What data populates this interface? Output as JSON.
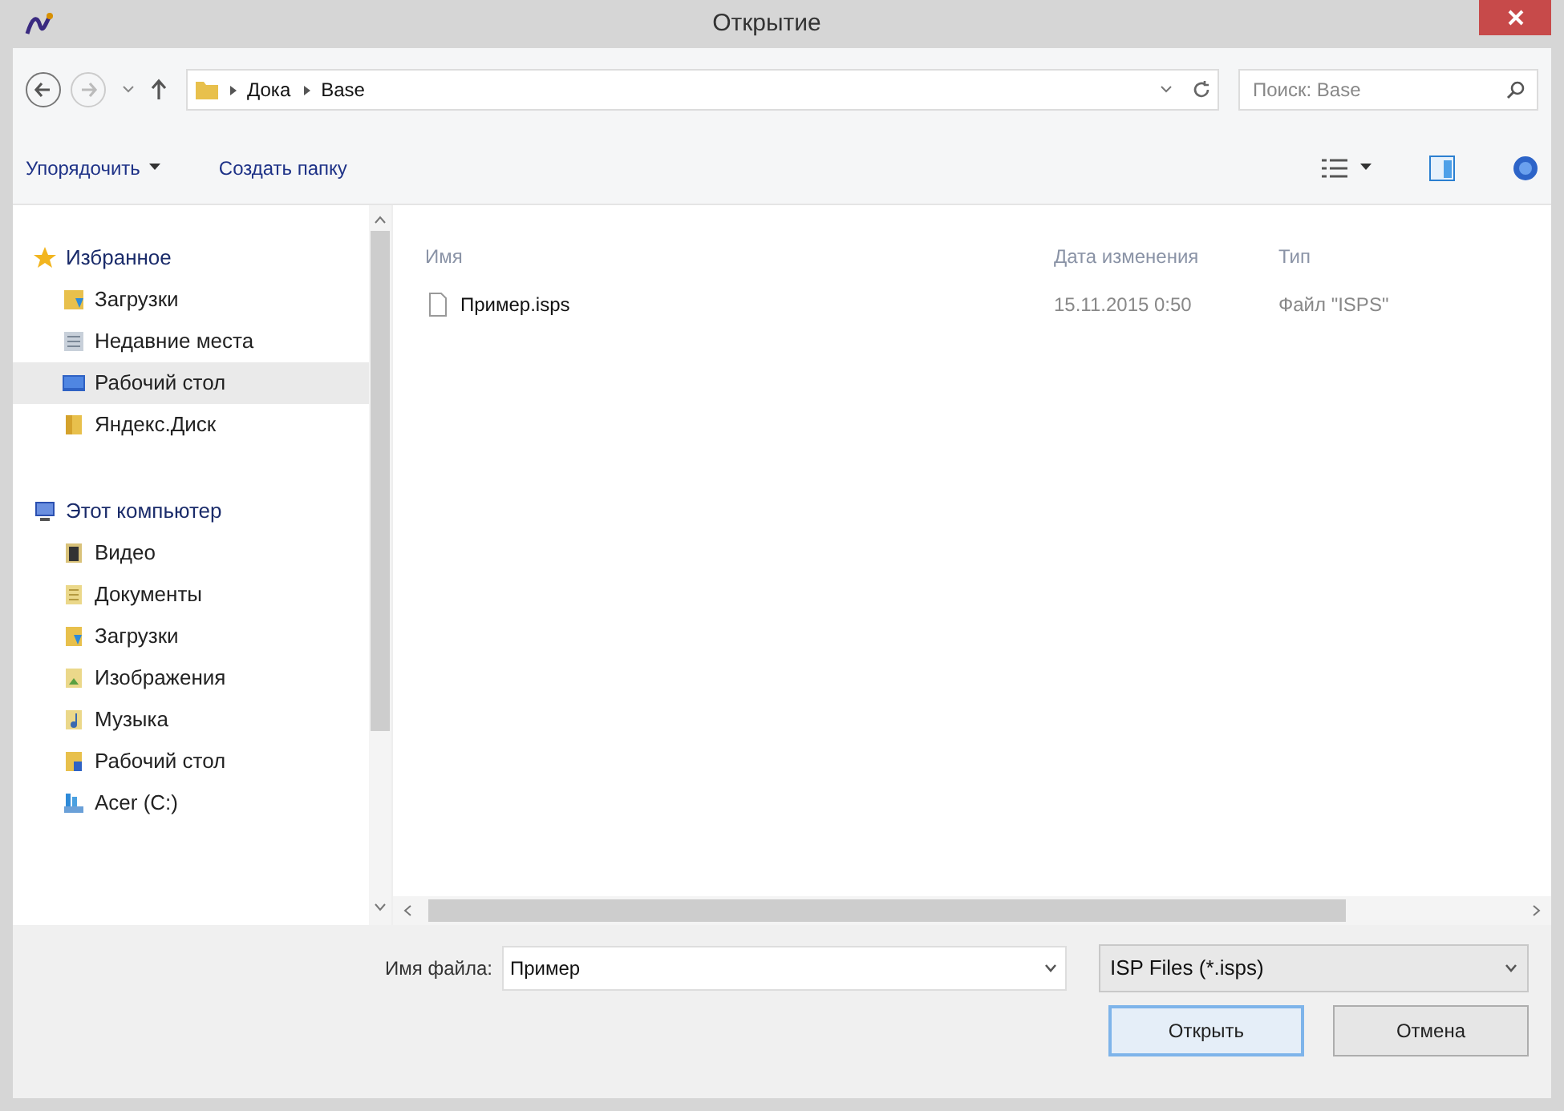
{
  "window": {
    "title": "Открытие"
  },
  "address_bar": {
    "path": [
      "Дока",
      "Base"
    ]
  },
  "search": {
    "placeholder": "Поиск: Base"
  },
  "toolbar": {
    "organize": "Упорядочить",
    "new_folder": "Создать папку"
  },
  "sidebar": {
    "groups": [
      {
        "label": "Избранное",
        "children": [
          {
            "label": "Загрузки",
            "selected": false
          },
          {
            "label": "Недавние места",
            "selected": false
          },
          {
            "label": "Рабочий стол",
            "selected": true
          },
          {
            "label": "Яндекс.Диск",
            "selected": false
          }
        ]
      },
      {
        "label": "Этот компьютер",
        "children": [
          {
            "label": "Видео",
            "selected": false
          },
          {
            "label": "Документы",
            "selected": false
          },
          {
            "label": "Загрузки",
            "selected": false
          },
          {
            "label": "Изображения",
            "selected": false
          },
          {
            "label": "Музыка",
            "selected": false
          },
          {
            "label": "Рабочий стол",
            "selected": false
          },
          {
            "label": "Acer (C:)",
            "selected": false
          }
        ]
      }
    ]
  },
  "file_list": {
    "columns": [
      "Имя",
      "Дата изменения",
      "Тип"
    ],
    "rows": [
      {
        "name": "Пример.isps",
        "modified": "15.11.2015 0:50",
        "type": "Файл \"ISPS\"",
        "selected": false
      }
    ]
  },
  "file_name": {
    "label": "Имя файла:",
    "value": "Пример"
  },
  "file_type": {
    "value": "ISP Files (*.isps)"
  },
  "buttons": [
    {
      "label": "Открыть",
      "default": true
    },
    {
      "label": "Отмена",
      "default": false
    }
  ]
}
